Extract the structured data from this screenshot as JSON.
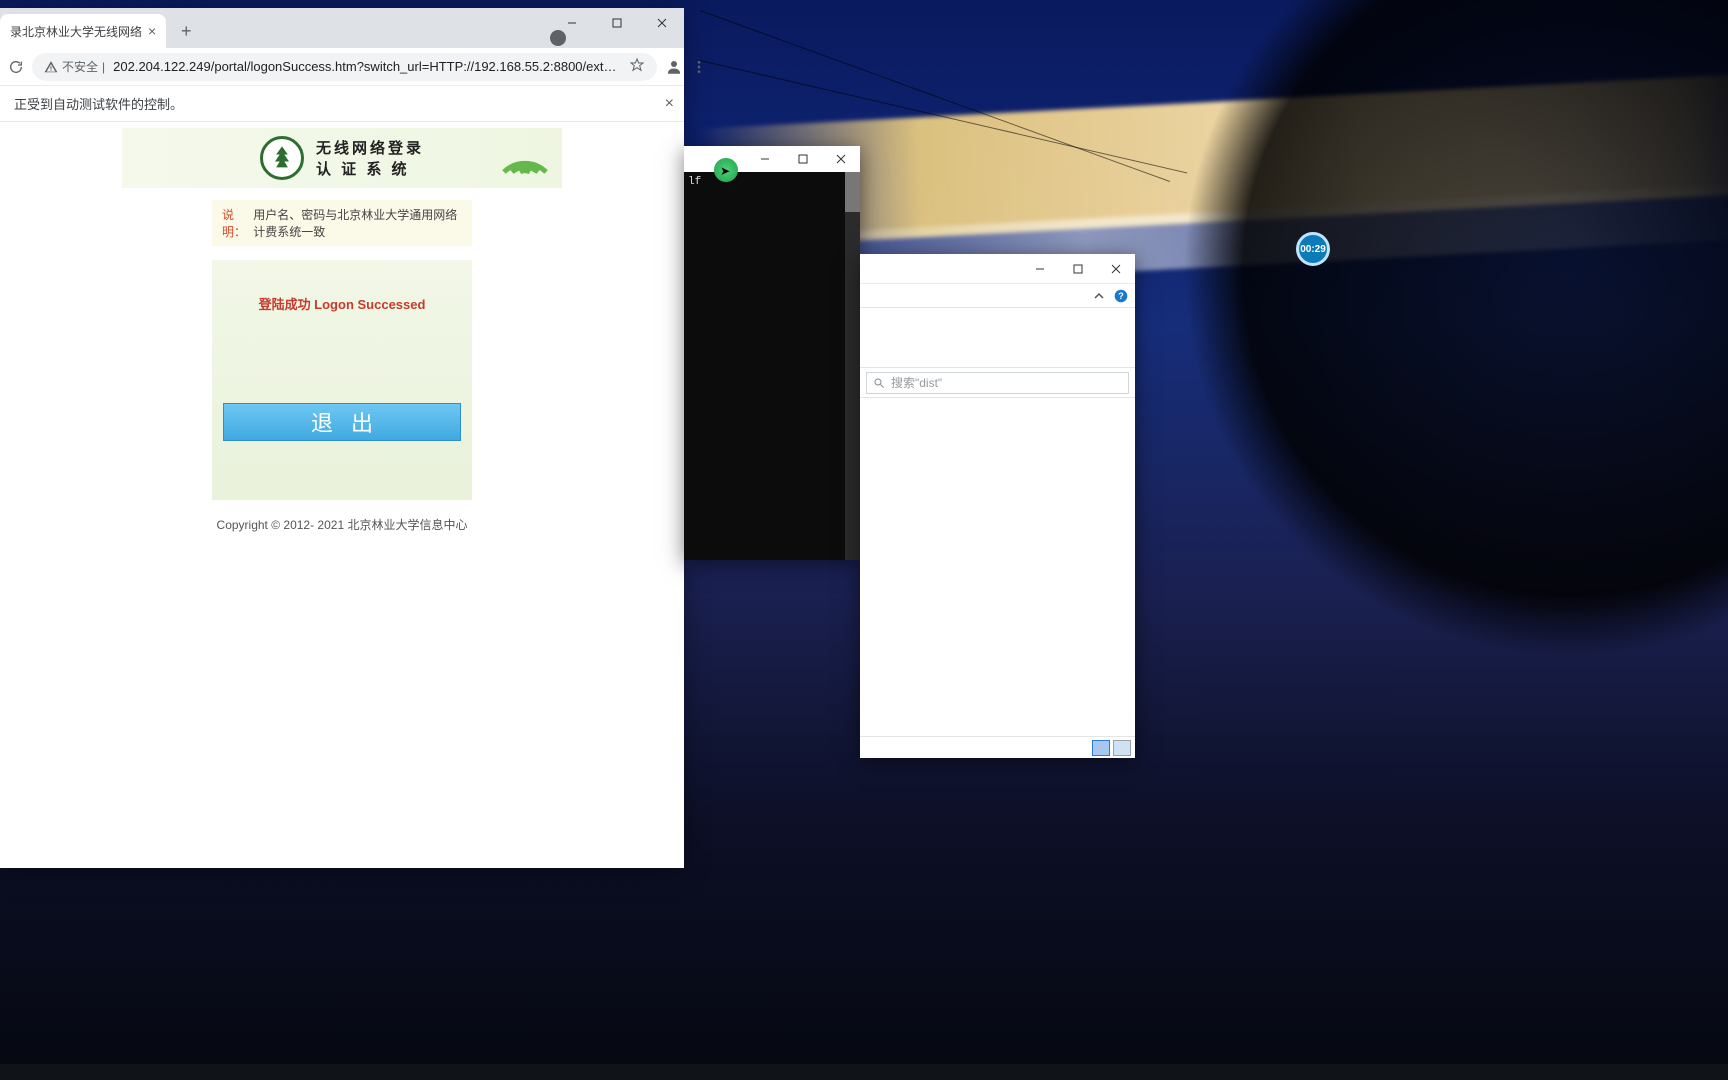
{
  "browser": {
    "tab_title": "录北京林业大学无线网络",
    "security_label": "不安全",
    "url": "202.204.122.249/portal/logonSuccess.htm?switch_url=HTTP://192.168.55.2:8800/ext_cp_l...",
    "infobar_text": "正受到自动测试软件的控制。"
  },
  "portal": {
    "title_line1": "无线网络登录",
    "title_line2": "认 证 系 统",
    "note_label": "说明：",
    "note_text": "用户名、密码与北京林业大学通用网络计费系统一致",
    "status_message": "登陆成功 Logon Successed",
    "logout_button": "退出",
    "copyright": "Copyright © 2012- 2021   北京林业大学信息中心"
  },
  "console": {
    "visible_text": "lf"
  },
  "explorer": {
    "search_placeholder": "搜索\"dist\""
  },
  "timer": {
    "value": "00:29"
  }
}
